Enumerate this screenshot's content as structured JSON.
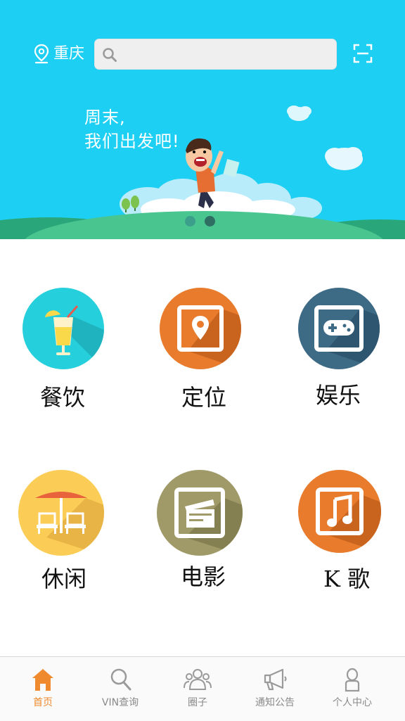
{
  "header": {
    "city": "重庆",
    "search_placeholder": "",
    "search_value": ""
  },
  "banner": {
    "slogan_line1": "周末,",
    "slogan_line2": "我们出发吧!",
    "slide_count": 2,
    "active_slide": 2
  },
  "categories": [
    {
      "label": "餐饮",
      "icon": "juice-icon",
      "color": "#26cfdc"
    },
    {
      "label": "定位",
      "icon": "location-pin-icon",
      "color": "#e87b2c"
    },
    {
      "label": "娱乐",
      "icon": "gamepad-icon",
      "color": "#3d6a85"
    },
    {
      "label": "休闲",
      "icon": "beach-umbrella-icon",
      "color": "#fbcd57"
    },
    {
      "label": "电影",
      "icon": "clapperboard-icon",
      "color": "#a09a68"
    },
    {
      "label": "K 歌",
      "icon": "music-note-icon",
      "color": "#e87b2c"
    }
  ],
  "tabs": [
    {
      "label": "首页",
      "icon": "home-icon",
      "active": true
    },
    {
      "label": "VIN查询",
      "icon": "search-icon",
      "active": false
    },
    {
      "label": "圈子",
      "icon": "people-icon",
      "active": false
    },
    {
      "label": "通知公告",
      "icon": "megaphone-icon",
      "active": false
    },
    {
      "label": "个人中心",
      "icon": "person-icon",
      "active": false
    }
  ],
  "colors": {
    "banner_bg": "#1dcff2",
    "accent": "#f08a2e",
    "tab_inactive": "#8a8a8a"
  }
}
